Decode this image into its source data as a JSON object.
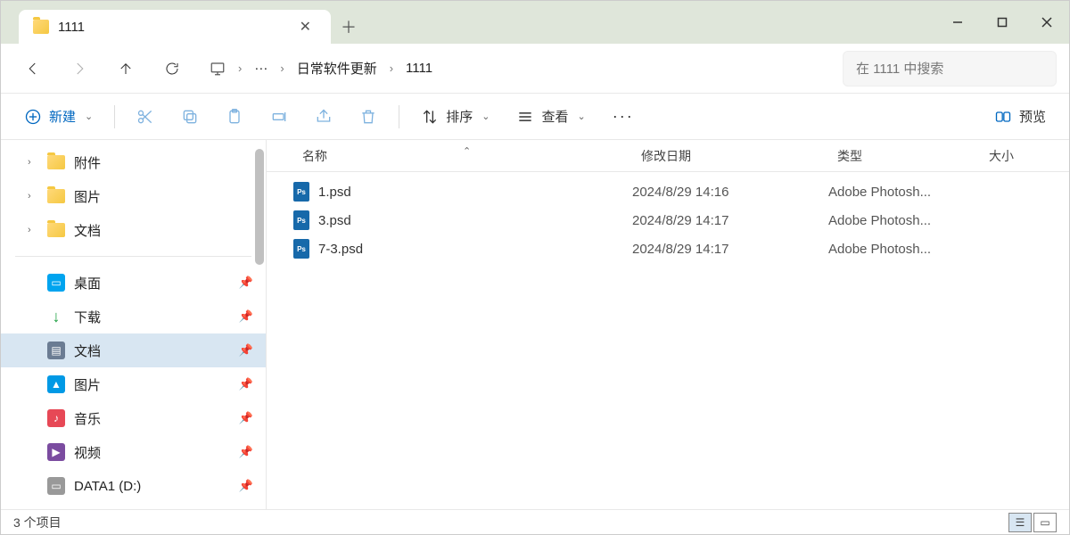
{
  "tab": {
    "title": "1111"
  },
  "breadcrumb": {
    "ellipsis": "···",
    "parent": "日常软件更新",
    "current": "1111"
  },
  "search": {
    "placeholder": "在 1111 中搜索"
  },
  "toolbar": {
    "new": "新建",
    "sort": "排序",
    "view": "查看",
    "preview": "预览"
  },
  "sidebar": {
    "tree": [
      {
        "label": "附件"
      },
      {
        "label": "图片"
      },
      {
        "label": "文档"
      }
    ],
    "quick": [
      {
        "label": "桌面",
        "icon": "desktop"
      },
      {
        "label": "下载",
        "icon": "download"
      },
      {
        "label": "文档",
        "icon": "docs",
        "selected": true
      },
      {
        "label": "图片",
        "icon": "pics"
      },
      {
        "label": "音乐",
        "icon": "music"
      },
      {
        "label": "视频",
        "icon": "video"
      },
      {
        "label": "DATA1 (D:)",
        "icon": "drive"
      }
    ]
  },
  "columns": {
    "name": "名称",
    "date": "修改日期",
    "type": "类型",
    "size": "大小"
  },
  "files": [
    {
      "name": "1.psd",
      "date": "2024/8/29 14:16",
      "type": "Adobe Photosh..."
    },
    {
      "name": "3.psd",
      "date": "2024/8/29 14:17",
      "type": "Adobe Photosh..."
    },
    {
      "name": "7-3.psd",
      "date": "2024/8/29 14:17",
      "type": "Adobe Photosh..."
    }
  ],
  "status": {
    "count": "3 个项目"
  }
}
